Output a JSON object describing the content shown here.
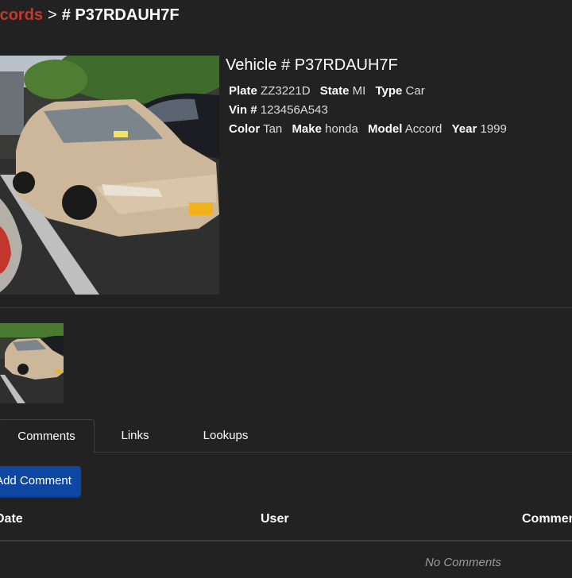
{
  "breadcrumb": {
    "parent": "Records",
    "separator": ">",
    "current": "# P37RDAUH7F"
  },
  "vehicle": {
    "title": "Vehicle # P37RDAUH7F",
    "plate_label": "Plate",
    "plate": "ZZ3221D",
    "state_label": "State",
    "state": "MI",
    "type_label": "Type",
    "type": "Car",
    "vin_label": "Vin #",
    "vin": "123456A543",
    "color_label": "Color",
    "color": "Tan",
    "make_label": "Make",
    "make": "honda",
    "model_label": "Model",
    "model": "Accord",
    "year_label": "Year",
    "year": "1999"
  },
  "tabs": [
    {
      "label": "Comments",
      "active": true
    },
    {
      "label": "Links",
      "active": false
    },
    {
      "label": "Lookups",
      "active": false
    }
  ],
  "actions": {
    "add_comment": "Add Comment"
  },
  "comments_table": {
    "headers": [
      "Date",
      "User",
      "Comment"
    ],
    "empty_text": "No Comments"
  },
  "colors": {
    "background": "#222222",
    "breadcrumb_link": "#c0392b",
    "button": "#0d47a1"
  }
}
